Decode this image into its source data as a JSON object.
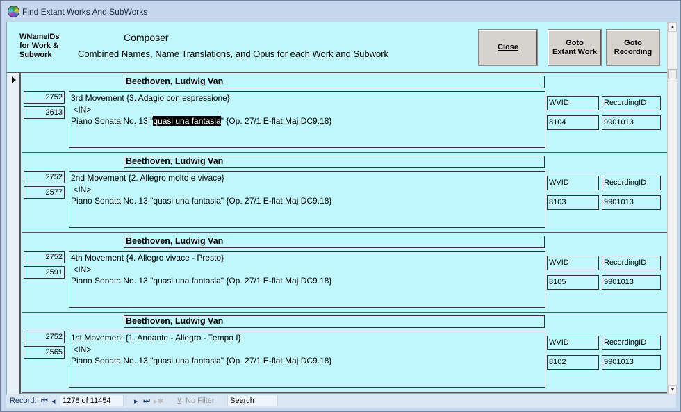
{
  "window": {
    "title": "Find Extant Works And SubWorks"
  },
  "header": {
    "ids_label": "WNameIDs for Work & Subwork",
    "ids_lines": [
      "WNameIDs",
      "for Work &",
      "Subwork"
    ],
    "composer_label": "Composer",
    "combined_label": "Combined Names, Name Translations, and Opus for each Work and Subwork"
  },
  "buttons": {
    "close": "Close",
    "goto_extant": [
      "Goto",
      "Extant Work"
    ],
    "goto_recording": [
      "Goto",
      "Recording"
    ]
  },
  "records": [
    {
      "composer": "Beethoven, Ludwig Van",
      "id1": "2752",
      "id2": "2613",
      "line1": "3rd Movement {3. Adagio con espressione}",
      "line2": " <IN>",
      "line3_pre": "Piano Sonata No. 13 \"",
      "line3_hl": "quasi una fantasia",
      "line3_post": "\" {Op. 27/1 E-flat Maj DC9.18}",
      "wvid_label": "WVID",
      "recid_label": "RecordingID",
      "wvid": "8104",
      "recid": "9901013",
      "current": true
    },
    {
      "composer": "Beethoven, Ludwig Van",
      "id1": "2752",
      "id2": "2577",
      "line1": "2nd Movement {2. Allegro molto e vivace}",
      "line2": " <IN>",
      "line3_pre": "Piano Sonata No. 13 \"quasi una fantasia\" {Op. 27/1 E-flat Maj DC9.18}",
      "line3_hl": "",
      "line3_post": "",
      "wvid_label": "WVID",
      "recid_label": "RecordingID",
      "wvid": "8103",
      "recid": "9901013"
    },
    {
      "composer": "Beethoven, Ludwig Van",
      "id1": "2752",
      "id2": "2591",
      "line1": "4th Movement {4. Allegro vivace - Presto}",
      "line2": " <IN>",
      "line3_pre": "Piano Sonata No. 13 \"quasi una fantasia\" {Op. 27/1 E-flat Maj DC9.18}",
      "line3_hl": "",
      "line3_post": "",
      "wvid_label": "WVID",
      "recid_label": "RecordingID",
      "wvid": "8105",
      "recid": "9901013"
    },
    {
      "composer": "Beethoven, Ludwig Van",
      "id1": "2752",
      "id2": "2565",
      "line1": "1st Movement {1. Andante - Allegro - Tempo I}",
      "line2": " <IN>",
      "line3_pre": "Piano Sonata No. 13 \"quasi una fantasia\" {Op. 27/1 E-flat Maj DC9.18}",
      "line3_hl": "",
      "line3_post": "",
      "wvid_label": "WVID",
      "recid_label": "RecordingID",
      "wvid": "8102",
      "recid": "9901013"
    }
  ],
  "navigation": {
    "record_label": "Record:",
    "position": "1278 of 11454",
    "filter": "No Filter",
    "search": "Search"
  }
}
